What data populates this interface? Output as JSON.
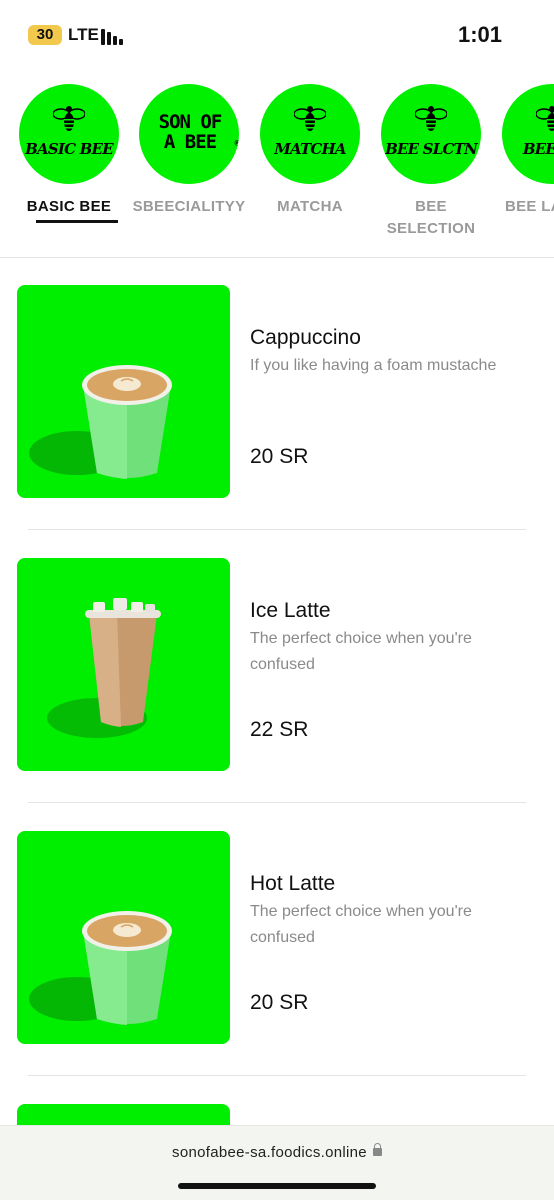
{
  "status_bar": {
    "battery": "30",
    "network": "LTE",
    "time": "1:01"
  },
  "categories": [
    {
      "label": "BASIC BEE",
      "logo": "BASIC BEE",
      "active": true
    },
    {
      "label": "SBEECIALITYY",
      "logo": "SON OF A BEE",
      "active": false
    },
    {
      "label": "MATCHA",
      "logo": "MATCHA",
      "active": false
    },
    {
      "label": "BEE SELECTION",
      "logo": "BEE SLCTN",
      "active": false
    },
    {
      "label": "BEE LA",
      "logo": "BEE LA",
      "active": false
    }
  ],
  "logo": {
    "line1": "SON OF",
    "line2": "A BEE",
    "reg": "®"
  },
  "menu_items": [
    {
      "name": "Cappuccino",
      "description": "If you like having a foam mustache",
      "price": "20 SR",
      "image": "hot-cup"
    },
    {
      "name": "Ice Latte",
      "description": "The perfect choice when you're confused",
      "price": "22 SR",
      "image": "iced-cup"
    },
    {
      "name": "Hot Latte",
      "description": "The perfect choice when you're confused",
      "price": "20 SR",
      "image": "hot-cup"
    }
  ],
  "url_bar": {
    "url": "sonofabee-sa.foodics.online"
  },
  "colors": {
    "brand_green": "#00f000",
    "cup_green": "#6fe07a",
    "text_muted": "#8a8a8a"
  }
}
